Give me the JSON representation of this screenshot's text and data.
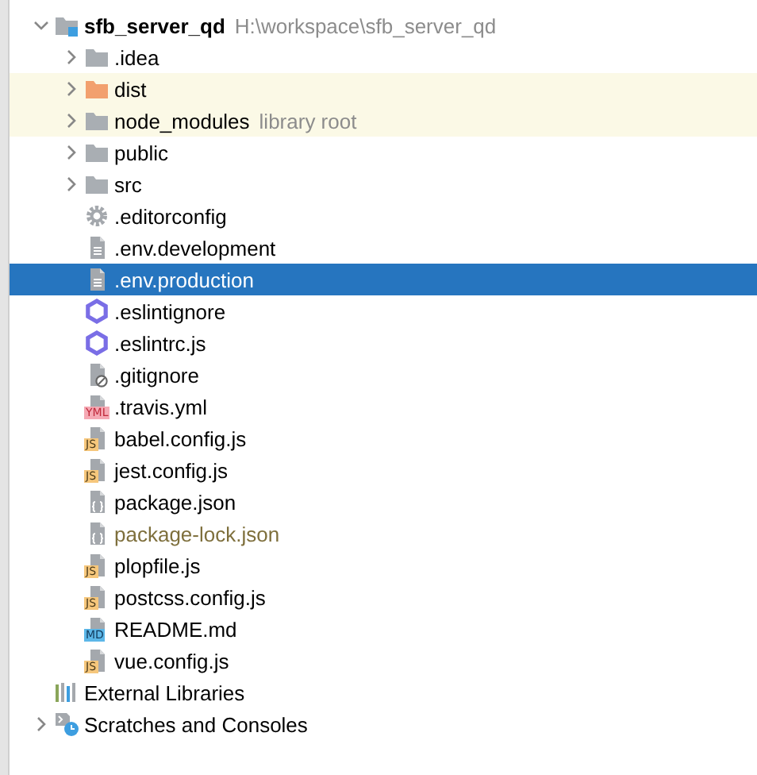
{
  "tree": [
    {
      "kind": "project",
      "name": "sfb_server_qd",
      "hint": "H:\\workspace\\sfb_server_qd",
      "expanded": true,
      "selected": false,
      "children": [
        {
          "kind": "folder",
          "name": ".idea",
          "expanded": false,
          "selected": false,
          "highlighted": false,
          "color": "#a9aeb3"
        },
        {
          "kind": "folder",
          "name": "dist",
          "expanded": false,
          "selected": false,
          "highlighted": true,
          "color": "#f2a06e"
        },
        {
          "kind": "folder",
          "name": "node_modules",
          "hint": "library root",
          "expanded": false,
          "selected": false,
          "highlighted": true,
          "color": "#a9aeb3"
        },
        {
          "kind": "folder",
          "name": "public",
          "expanded": false,
          "selected": false,
          "highlighted": false,
          "color": "#a9aeb3"
        },
        {
          "kind": "folder",
          "name": "src",
          "expanded": false,
          "selected": false,
          "highlighted": false,
          "color": "#a9aeb3"
        },
        {
          "kind": "config",
          "name": ".editorconfig",
          "selected": false
        },
        {
          "kind": "text",
          "name": ".env.development",
          "selected": false
        },
        {
          "kind": "text",
          "name": ".env.production",
          "selected": true
        },
        {
          "kind": "eslint",
          "name": ".eslintignore",
          "selected": false
        },
        {
          "kind": "eslint",
          "name": ".eslintrc.js",
          "selected": false
        },
        {
          "kind": "ignore",
          "name": ".gitignore",
          "selected": false
        },
        {
          "kind": "yml",
          "badge": "YML",
          "name": ".travis.yml",
          "selected": false
        },
        {
          "kind": "js",
          "badge": "JS",
          "name": "babel.config.js",
          "selected": false
        },
        {
          "kind": "js",
          "badge": "JS",
          "name": "jest.config.js",
          "selected": false
        },
        {
          "kind": "json",
          "name": "package.json",
          "selected": false,
          "ignored": false
        },
        {
          "kind": "json",
          "name": "package-lock.json",
          "selected": false,
          "ignored": true
        },
        {
          "kind": "js",
          "badge": "JS",
          "name": "plopfile.js",
          "selected": false
        },
        {
          "kind": "js",
          "badge": "JS",
          "name": "postcss.config.js",
          "selected": false
        },
        {
          "kind": "md",
          "badge": "MD",
          "name": "README.md",
          "selected": false
        },
        {
          "kind": "js",
          "badge": "JS",
          "name": "vue.config.js",
          "selected": false
        }
      ]
    },
    {
      "kind": "libraries",
      "name": "External Libraries",
      "selected": false
    },
    {
      "kind": "scratches",
      "name": "Scratches and Consoles",
      "expanded": false,
      "selected": false
    }
  ]
}
